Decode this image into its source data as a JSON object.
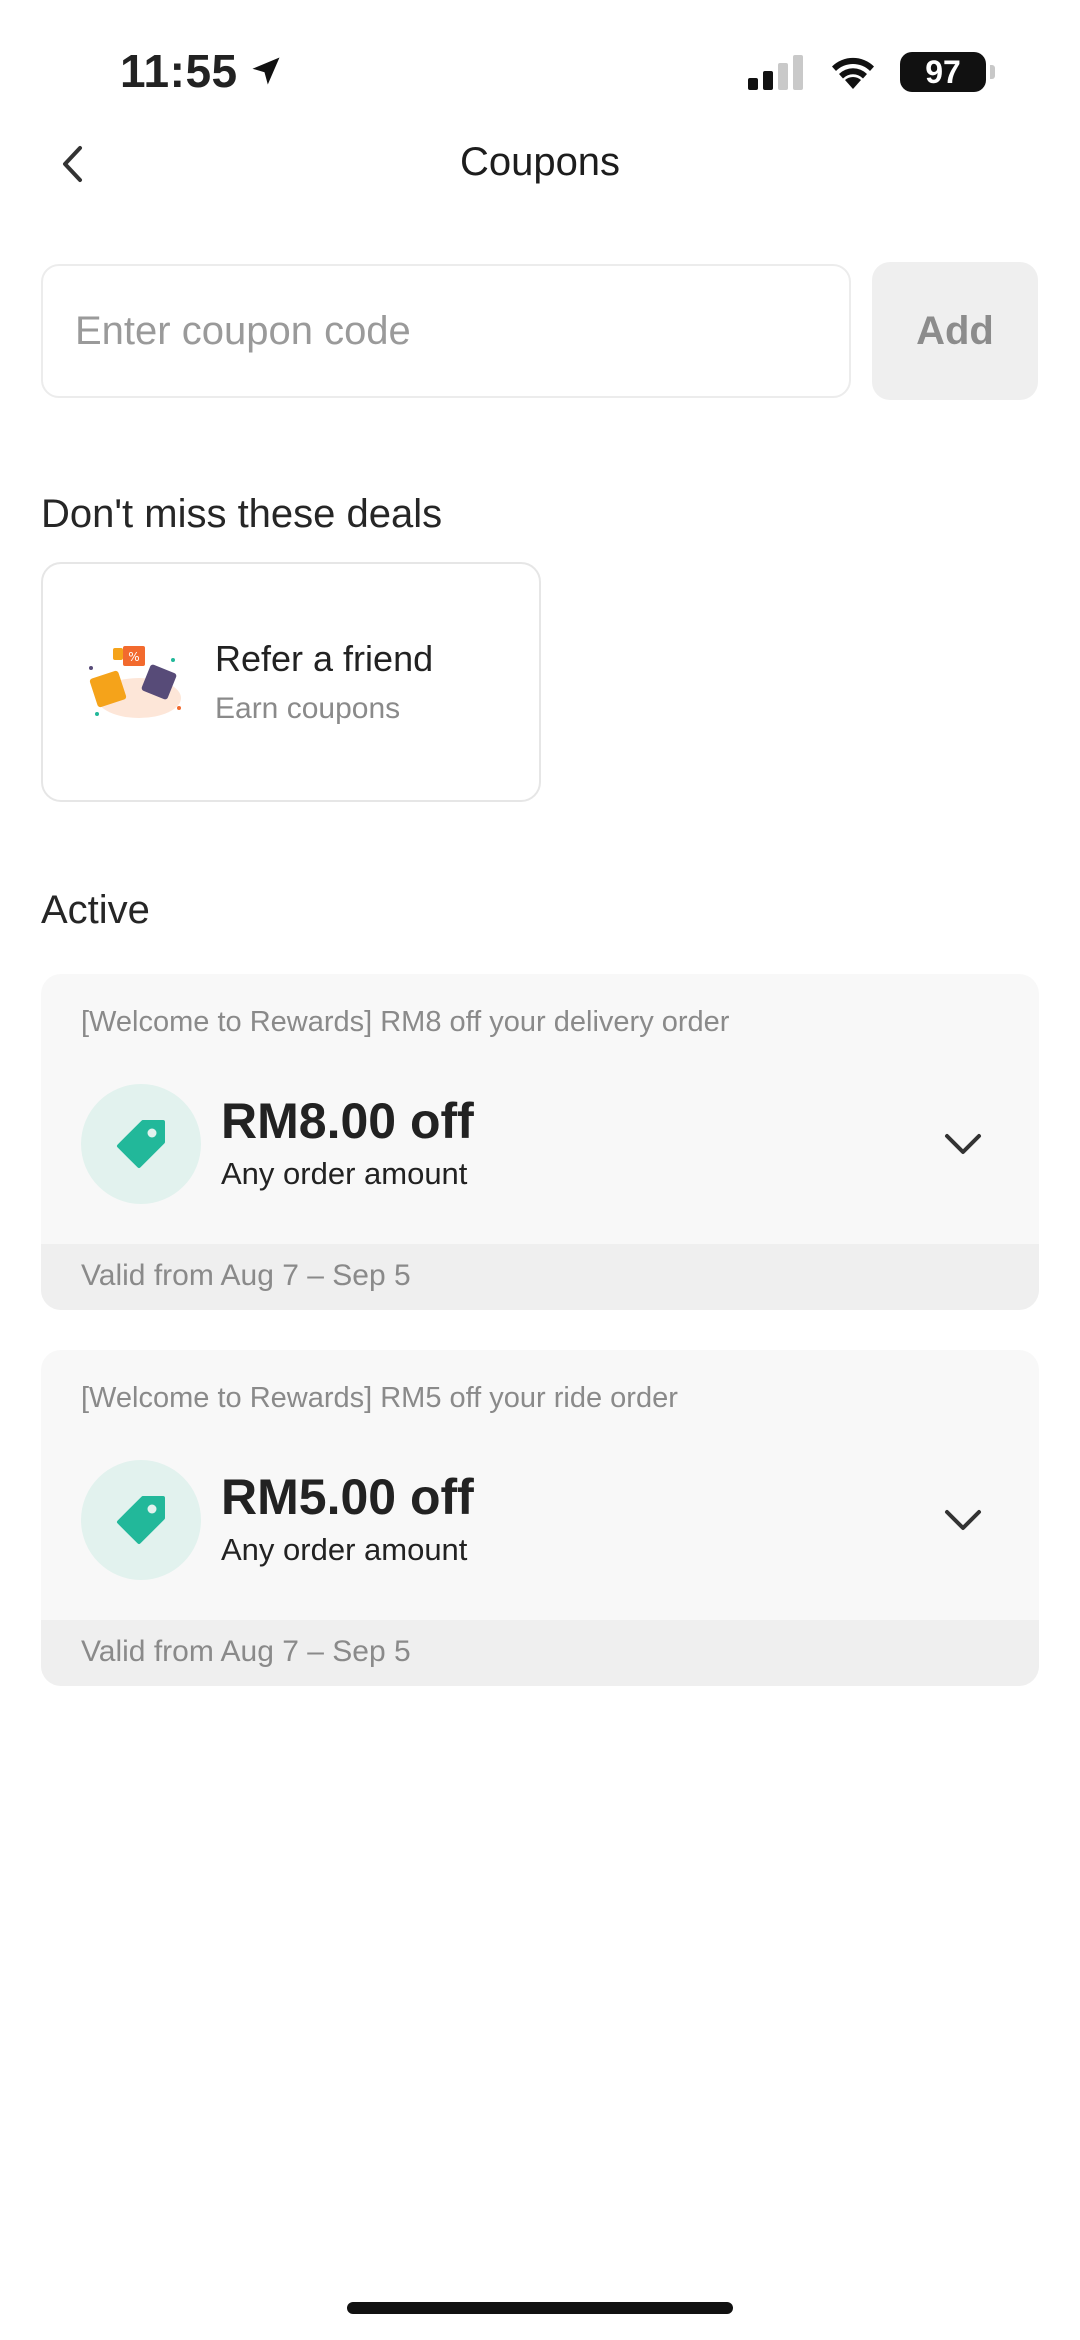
{
  "status_bar": {
    "time": "11:55",
    "battery": "97"
  },
  "header": {
    "title": "Coupons"
  },
  "coupon_entry": {
    "placeholder": "Enter coupon code",
    "value": "",
    "add_label": "Add"
  },
  "deals": {
    "title": "Don't miss these deals",
    "items": [
      {
        "title": "Refer a friend",
        "subtitle": "Earn coupons"
      }
    ]
  },
  "active": {
    "title": "Active",
    "coupons": [
      {
        "description": "[Welcome to Rewards] RM8 off your delivery order",
        "amount": "RM8.00 off",
        "condition": "Any order amount",
        "validity": "Valid from Aug 7 – Sep 5"
      },
      {
        "description": "[Welcome to Rewards] RM5 off your ride order",
        "amount": "RM5.00 off",
        "condition": "Any order amount",
        "validity": "Valid from Aug 7 – Sep 5"
      }
    ]
  },
  "colors": {
    "accent": "#22b89a",
    "icon_bg": "#e2f2ee",
    "card_bg": "#f8f8f8",
    "footer_bg": "#efefef"
  },
  "icons": [
    "location-arrow-icon",
    "cellular-signal-icon",
    "wifi-icon",
    "battery-icon",
    "back-chevron-icon",
    "tag-icon",
    "chevron-down-icon"
  ]
}
